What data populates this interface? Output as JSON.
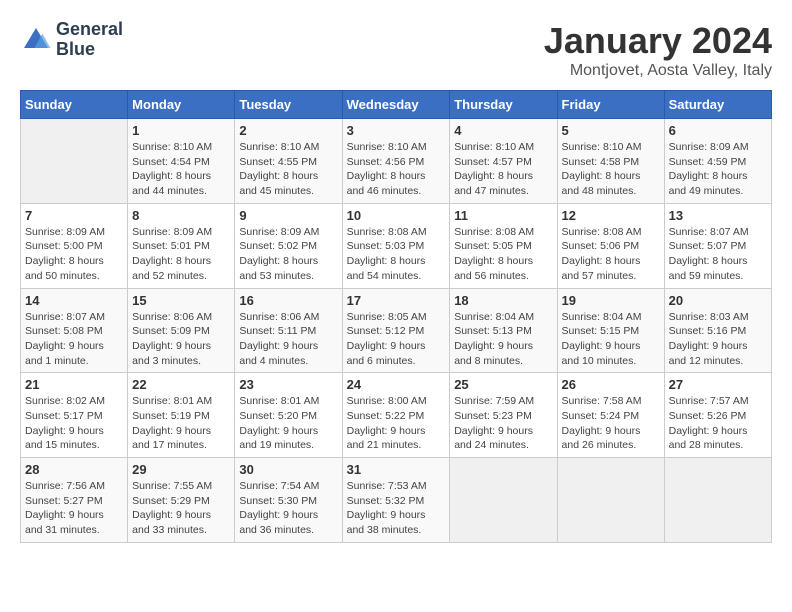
{
  "header": {
    "logo_line1": "General",
    "logo_line2": "Blue",
    "month": "January 2024",
    "location": "Montjovet, Aosta Valley, Italy"
  },
  "weekdays": [
    "Sunday",
    "Monday",
    "Tuesday",
    "Wednesday",
    "Thursday",
    "Friday",
    "Saturday"
  ],
  "weeks": [
    [
      {
        "day": "",
        "info": ""
      },
      {
        "day": "1",
        "info": "Sunrise: 8:10 AM\nSunset: 4:54 PM\nDaylight: 8 hours\nand 44 minutes."
      },
      {
        "day": "2",
        "info": "Sunrise: 8:10 AM\nSunset: 4:55 PM\nDaylight: 8 hours\nand 45 minutes."
      },
      {
        "day": "3",
        "info": "Sunrise: 8:10 AM\nSunset: 4:56 PM\nDaylight: 8 hours\nand 46 minutes."
      },
      {
        "day": "4",
        "info": "Sunrise: 8:10 AM\nSunset: 4:57 PM\nDaylight: 8 hours\nand 47 minutes."
      },
      {
        "day": "5",
        "info": "Sunrise: 8:10 AM\nSunset: 4:58 PM\nDaylight: 8 hours\nand 48 minutes."
      },
      {
        "day": "6",
        "info": "Sunrise: 8:09 AM\nSunset: 4:59 PM\nDaylight: 8 hours\nand 49 minutes."
      }
    ],
    [
      {
        "day": "7",
        "info": "Sunrise: 8:09 AM\nSunset: 5:00 PM\nDaylight: 8 hours\nand 50 minutes."
      },
      {
        "day": "8",
        "info": "Sunrise: 8:09 AM\nSunset: 5:01 PM\nDaylight: 8 hours\nand 52 minutes."
      },
      {
        "day": "9",
        "info": "Sunrise: 8:09 AM\nSunset: 5:02 PM\nDaylight: 8 hours\nand 53 minutes."
      },
      {
        "day": "10",
        "info": "Sunrise: 8:08 AM\nSunset: 5:03 PM\nDaylight: 8 hours\nand 54 minutes."
      },
      {
        "day": "11",
        "info": "Sunrise: 8:08 AM\nSunset: 5:05 PM\nDaylight: 8 hours\nand 56 minutes."
      },
      {
        "day": "12",
        "info": "Sunrise: 8:08 AM\nSunset: 5:06 PM\nDaylight: 8 hours\nand 57 minutes."
      },
      {
        "day": "13",
        "info": "Sunrise: 8:07 AM\nSunset: 5:07 PM\nDaylight: 8 hours\nand 59 minutes."
      }
    ],
    [
      {
        "day": "14",
        "info": "Sunrise: 8:07 AM\nSunset: 5:08 PM\nDaylight: 9 hours\nand 1 minute."
      },
      {
        "day": "15",
        "info": "Sunrise: 8:06 AM\nSunset: 5:09 PM\nDaylight: 9 hours\nand 3 minutes."
      },
      {
        "day": "16",
        "info": "Sunrise: 8:06 AM\nSunset: 5:11 PM\nDaylight: 9 hours\nand 4 minutes."
      },
      {
        "day": "17",
        "info": "Sunrise: 8:05 AM\nSunset: 5:12 PM\nDaylight: 9 hours\nand 6 minutes."
      },
      {
        "day": "18",
        "info": "Sunrise: 8:04 AM\nSunset: 5:13 PM\nDaylight: 9 hours\nand 8 minutes."
      },
      {
        "day": "19",
        "info": "Sunrise: 8:04 AM\nSunset: 5:15 PM\nDaylight: 9 hours\nand 10 minutes."
      },
      {
        "day": "20",
        "info": "Sunrise: 8:03 AM\nSunset: 5:16 PM\nDaylight: 9 hours\nand 12 minutes."
      }
    ],
    [
      {
        "day": "21",
        "info": "Sunrise: 8:02 AM\nSunset: 5:17 PM\nDaylight: 9 hours\nand 15 minutes."
      },
      {
        "day": "22",
        "info": "Sunrise: 8:01 AM\nSunset: 5:19 PM\nDaylight: 9 hours\nand 17 minutes."
      },
      {
        "day": "23",
        "info": "Sunrise: 8:01 AM\nSunset: 5:20 PM\nDaylight: 9 hours\nand 19 minutes."
      },
      {
        "day": "24",
        "info": "Sunrise: 8:00 AM\nSunset: 5:22 PM\nDaylight: 9 hours\nand 21 minutes."
      },
      {
        "day": "25",
        "info": "Sunrise: 7:59 AM\nSunset: 5:23 PM\nDaylight: 9 hours\nand 24 minutes."
      },
      {
        "day": "26",
        "info": "Sunrise: 7:58 AM\nSunset: 5:24 PM\nDaylight: 9 hours\nand 26 minutes."
      },
      {
        "day": "27",
        "info": "Sunrise: 7:57 AM\nSunset: 5:26 PM\nDaylight: 9 hours\nand 28 minutes."
      }
    ],
    [
      {
        "day": "28",
        "info": "Sunrise: 7:56 AM\nSunset: 5:27 PM\nDaylight: 9 hours\nand 31 minutes."
      },
      {
        "day": "29",
        "info": "Sunrise: 7:55 AM\nSunset: 5:29 PM\nDaylight: 9 hours\nand 33 minutes."
      },
      {
        "day": "30",
        "info": "Sunrise: 7:54 AM\nSunset: 5:30 PM\nDaylight: 9 hours\nand 36 minutes."
      },
      {
        "day": "31",
        "info": "Sunrise: 7:53 AM\nSunset: 5:32 PM\nDaylight: 9 hours\nand 38 minutes."
      },
      {
        "day": "",
        "info": ""
      },
      {
        "day": "",
        "info": ""
      },
      {
        "day": "",
        "info": ""
      }
    ]
  ]
}
